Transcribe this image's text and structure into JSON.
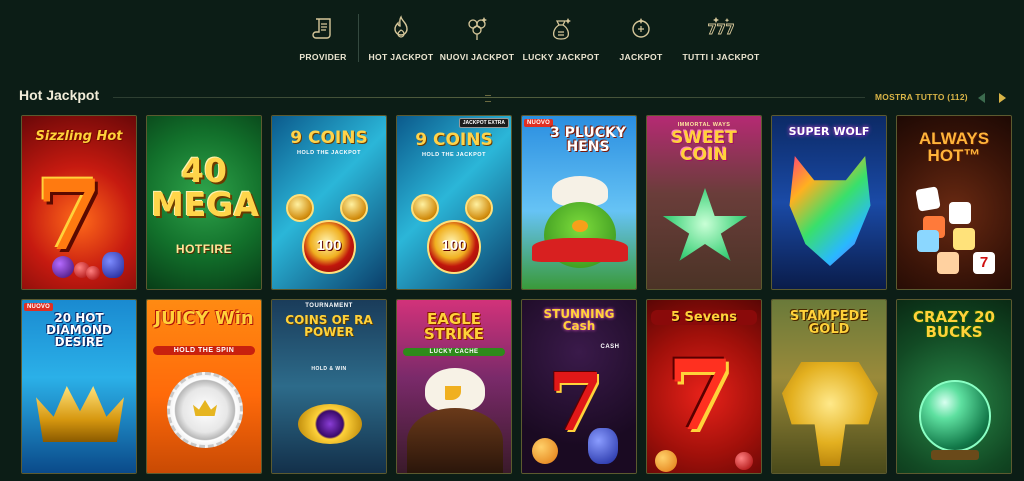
{
  "nav": {
    "items": [
      {
        "label": "PROVIDER",
        "icon": "scroll-icon"
      },
      {
        "label": "HOT JACKPOT",
        "icon": "flame-icon"
      },
      {
        "label": "NUOVI JACKPOT",
        "icon": "clover-icon"
      },
      {
        "label": "LUCKY JACKPOT",
        "icon": "money-bag-icon"
      },
      {
        "label": "JACKPOT",
        "icon": "jackpot-coin-icon"
      },
      {
        "label": "TUTTI I JACKPOT",
        "icon": "777-icon"
      }
    ]
  },
  "section": {
    "title": "Hot Jackpot",
    "show_all": "MOSTRA TUTTO (112)"
  },
  "games": [
    {
      "title": "Sizzling Hot",
      "art": "777"
    },
    {
      "title": "40 MEGA",
      "sub": "HOTFIRE"
    },
    {
      "title": "9 COINS",
      "sub": "HOLD THE JACKPOT",
      "value": "100"
    },
    {
      "title": "9 COINS",
      "sub": "HOLD THE JACKPOT",
      "value": "100",
      "badge": "JACKPOT EXTRA"
    },
    {
      "title": "3 PLUCKY HENS",
      "badge": "NUOVO"
    },
    {
      "title": "SWEET COIN",
      "sub": "IMMORTAL WAYS"
    },
    {
      "title": "SUPER WOLF"
    },
    {
      "title": "ALWAYS HOT™",
      "sub": "7"
    },
    {
      "title": "20 HOT DIAMOND DESIRE",
      "badge": "NUOVO"
    },
    {
      "title": "JUICY Win",
      "sub": "HOLD THE SPIN"
    },
    {
      "title": "COINS OF RA POWER",
      "sub": "HOLD & WIN",
      "tag": "TOURNAMENT"
    },
    {
      "title": "EAGLE STRIKE",
      "sub": "LUCKY CACHE"
    },
    {
      "title": "STUNNING Cash",
      "sub": "CASH"
    },
    {
      "title": "5 Sevens"
    },
    {
      "title": "STAMPEDE GOLD"
    },
    {
      "title": "CRAZY 20 BUCKS"
    }
  ],
  "colors": {
    "background": "#0c1d16",
    "accent": "#d9b447",
    "tile_border": "#5c5a2f"
  }
}
